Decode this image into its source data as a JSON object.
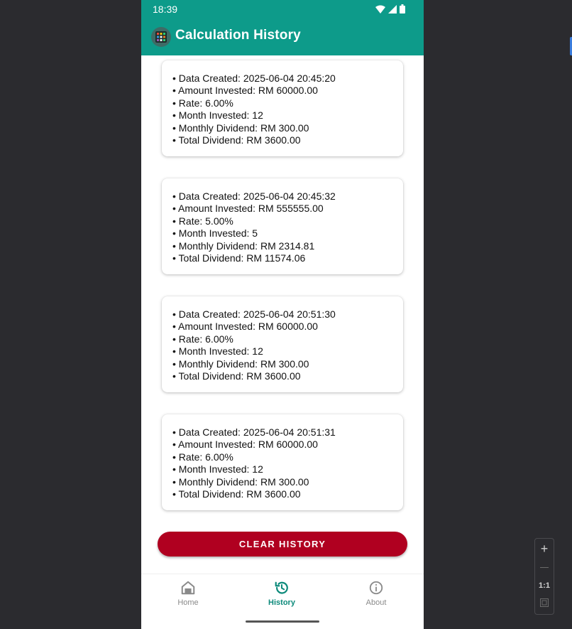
{
  "status_bar": {
    "time": "18:39"
  },
  "app_bar": {
    "title": "Calculation History",
    "logo_icon": "calculator-icon"
  },
  "history": [
    {
      "created": "• Data Created: 2025-06-04 20:45:20",
      "amount": "• Amount Invested: RM 60000.00",
      "rate": "• Rate: 6.00%",
      "months": "• Month Invested: 12",
      "monthly": "• Monthly Dividend: RM 300.00",
      "total": "• Total Dividend: RM 3600.00"
    },
    {
      "created": "• Data Created: 2025-06-04 20:45:32",
      "amount": "• Amount Invested: RM 555555.00",
      "rate": "• Rate: 5.00%",
      "months": "• Month Invested: 5",
      "monthly": "• Monthly Dividend: RM 2314.81",
      "total": "• Total Dividend: RM 11574.06"
    },
    {
      "created": "• Data Created: 2025-06-04 20:51:30",
      "amount": "• Amount Invested: RM 60000.00",
      "rate": "• Rate: 6.00%",
      "months": "• Month Invested: 12",
      "monthly": "• Monthly Dividend: RM 300.00",
      "total": "• Total Dividend: RM 3600.00"
    },
    {
      "created": "• Data Created: 2025-06-04 20:51:31",
      "amount": "• Amount Invested: RM 60000.00",
      "rate": "• Rate: 6.00%",
      "months": "• Month Invested: 12",
      "monthly": "• Monthly Dividend: RM 300.00",
      "total": "• Total Dividend: RM 3600.00"
    }
  ],
  "clear_button": "CLEAR HISTORY",
  "bottom_nav": [
    {
      "label": "Home",
      "icon": "home-icon"
    },
    {
      "label": "History",
      "icon": "history-icon"
    },
    {
      "label": "About",
      "icon": "info-icon"
    }
  ],
  "zoom_controls": {
    "one_to_one": "1:1"
  },
  "colors": {
    "primary": "#0d9b8a",
    "danger": "#b00020",
    "nav_active": "#0d8a7b"
  }
}
